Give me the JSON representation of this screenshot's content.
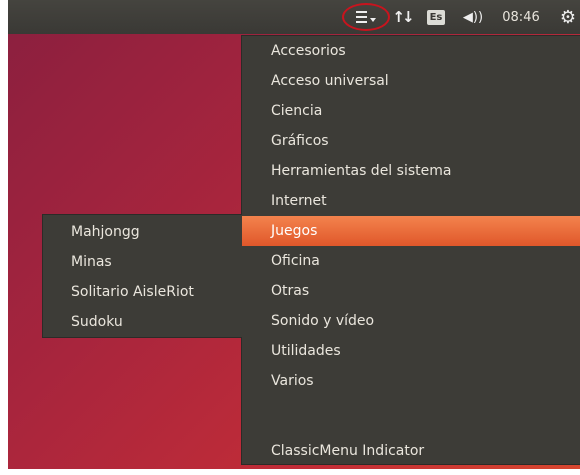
{
  "panel": {
    "menu_icon": "hamburger-menu-icon",
    "network_icon": "network-arrows-icon",
    "keyboard_layout": "Es",
    "volume_icon": "volume-icon",
    "clock": "08:46",
    "system_icon": "gear-icon"
  },
  "main_menu": {
    "items": [
      {
        "label": "Accesorios"
      },
      {
        "label": "Acceso universal"
      },
      {
        "label": "Ciencia"
      },
      {
        "label": "Gráficos"
      },
      {
        "label": "Herramientas del sistema"
      },
      {
        "label": "Internet"
      },
      {
        "label": "Juegos",
        "active": true
      },
      {
        "label": "Oficina"
      },
      {
        "label": "Otras"
      },
      {
        "label": "Sonido y vídeo"
      },
      {
        "label": "Utilidades"
      },
      {
        "label": "Varios"
      }
    ],
    "footer_item": "ClassicMenu Indicator",
    "chevron": "›"
  },
  "submenu": {
    "items": [
      "Mahjongg",
      "Minas",
      "Solitario AisleRiot",
      "Sudoku"
    ]
  },
  "colors": {
    "highlight": "#e95420",
    "panel": "#3c3b37",
    "annotation_ring": "#c8141e"
  }
}
